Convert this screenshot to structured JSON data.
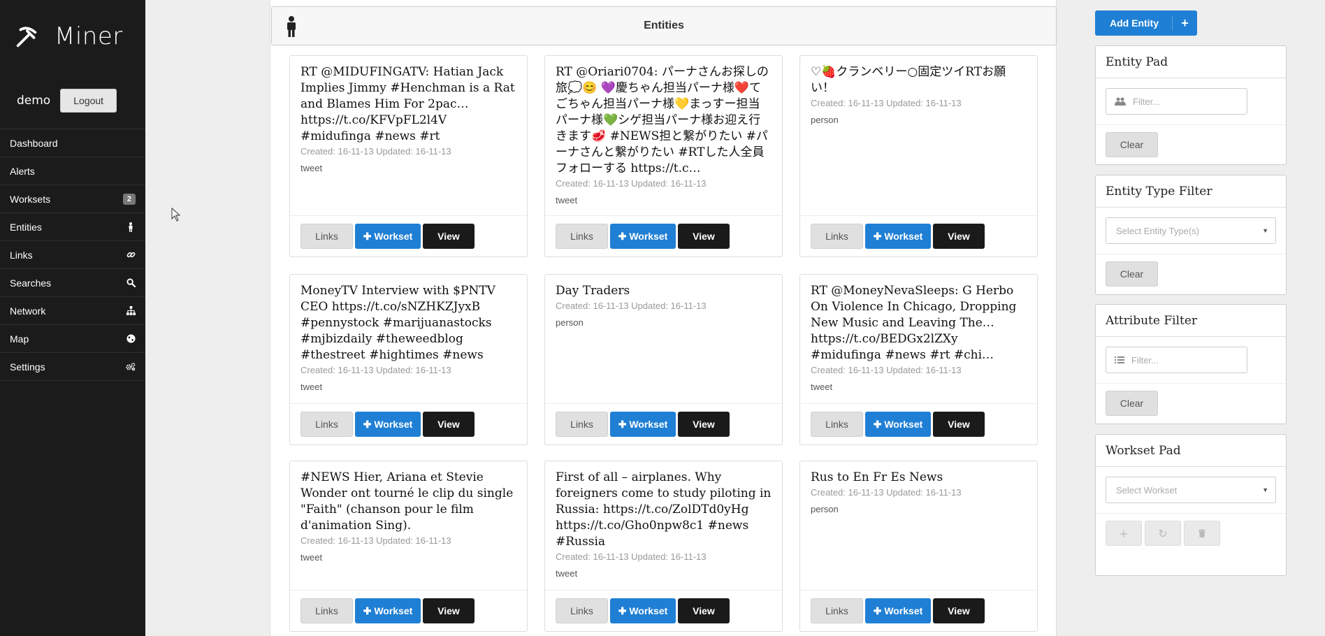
{
  "app": {
    "name": "Miner"
  },
  "user": {
    "name": "demo",
    "logout_label": "Logout"
  },
  "nav": [
    {
      "label": "Dashboard",
      "icon": ""
    },
    {
      "label": "Alerts",
      "icon": ""
    },
    {
      "label": "Worksets",
      "badge": "2"
    },
    {
      "label": "Entities",
      "icon": "person-icon"
    },
    {
      "label": "Links",
      "icon": "link-icon"
    },
    {
      "label": "Searches",
      "icon": "search-icon"
    },
    {
      "label": "Network",
      "icon": "sitemap-icon"
    },
    {
      "label": "Map",
      "icon": "globe-icon"
    },
    {
      "label": "Settings",
      "icon": "cogs-icon"
    }
  ],
  "entities_header": {
    "title": "Entities",
    "icon": "person-icon"
  },
  "buttons": {
    "links": "Links",
    "workset": "Workset",
    "view": "View"
  },
  "cards": [
    {
      "title": "RT @MIDUFINGATV: Hatian Jack Implies Jimmy #Henchman is a Rat and Blames Him For 2pac… https://t.co/KFVpFL2l4V #midufinga #news #rt",
      "meta": "Created: 16-11-13 Updated: 16-11-13",
      "type": "tweet"
    },
    {
      "title": "RT @Oriari0704: パーナさんお探しの旅💭😊 💜慶ちゃん担当パーナ様❤️てごちゃん担当パーナ様💛まっすー担当パーナ様💚シゲ担当パーナ様お迎え行きます🥩 #NEWS担と繋がりたい #パーナさんと繋がりたい #RTした人全員フォローする https://t.c…",
      "meta": "Created: 16-11-13 Updated: 16-11-13",
      "type": "tweet"
    },
    {
      "title": "♡🍓クランベリー○固定ツイRTお願い！",
      "meta": "Created: 16-11-13 Updated: 16-11-13",
      "type": "person"
    },
    {
      "title": "MoneyTV Interview with $PNTV CEO https://t.co/sNZHKZJyxB #pennystock #marijuanastocks #mjbizdaily #theweedblog #thestreet #hightimes #news",
      "meta": "Created: 16-11-13 Updated: 16-11-13",
      "type": "tweet"
    },
    {
      "title": "Day Traders",
      "meta": "Created: 16-11-13 Updated: 16-11-13",
      "type": "person"
    },
    {
      "title": "RT @MoneyNevaSleeps: G Herbo On Violence In Chicago, Dropping New Music and Leaving The… https://t.co/BEDGx2lZXy #midufinga #news #rt #chi…",
      "meta": "Created: 16-11-13 Updated: 16-11-13",
      "type": "tweet"
    },
    {
      "title": "#NEWS Hier, Ariana et Stevie Wonder ont tourné le clip du single \"Faith\" (chanson pour le film d'animation Sing).",
      "meta": "Created: 16-11-13 Updated: 16-11-13",
      "type": "tweet"
    },
    {
      "title": "First of all – airplanes. Why foreigners come to study piloting in Russia: https://t.co/ZolDTd0yHg https://t.co/Gho0npw8c1 #news #Russia",
      "meta": "Created: 16-11-13 Updated: 16-11-13",
      "type": "tweet"
    },
    {
      "title": "Rus to En Fr Es News",
      "meta": "Created: 16-11-13 Updated: 16-11-13",
      "type": "person"
    }
  ],
  "right": {
    "add_entity_label": "Add Entity",
    "entity_pad": {
      "title": "Entity Pad",
      "placeholder": "Filter...",
      "clear": "Clear"
    },
    "entity_type_filter": {
      "title": "Entity Type Filter",
      "placeholder": "Select Entity Type(s)",
      "clear": "Clear"
    },
    "attribute_filter": {
      "title": "Attribute Filter",
      "placeholder": "Filter...",
      "clear": "Clear"
    },
    "workset_pad": {
      "title": "Workset Pad",
      "placeholder": "Select Workset"
    }
  },
  "colors": {
    "sidebar": "#1b1b1b",
    "primary": "#1f7fd4",
    "dark_button": "#1a1a1a"
  }
}
